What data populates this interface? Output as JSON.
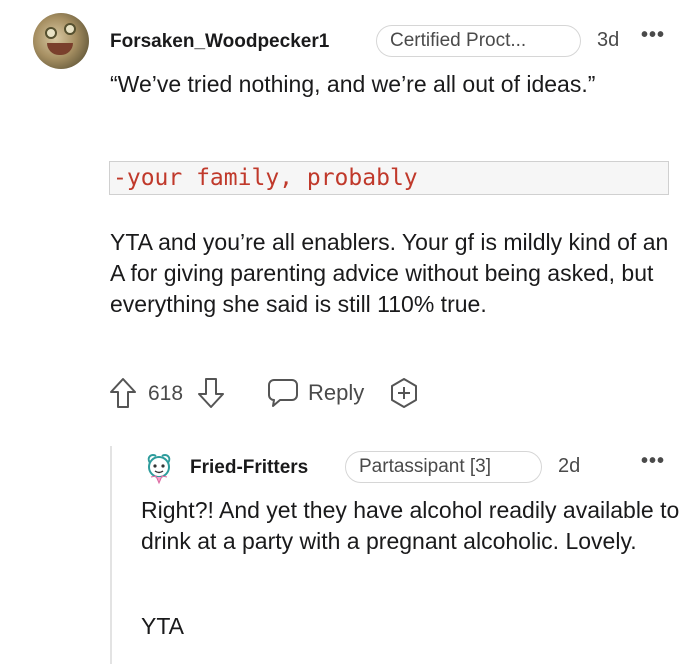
{
  "comment": {
    "username": "Forsaken_Woodpecker1",
    "flair": "Certified Proct...",
    "age": "3d",
    "more": "•••",
    "quote": "“We’ve tried nothing, and we’re all out of ideas.”",
    "code": "-your family, probably",
    "paragraph": "YTA and you’re all enablers. Your gf is mildly kind of an A for giving parenting advice without being asked, but everything she said is still 110% true.",
    "score": "618",
    "reply_label": "Reply",
    "icons": [
      "upvote-icon",
      "downvote-icon",
      "reply-icon",
      "award-icon",
      "more-icon"
    ]
  },
  "reply": {
    "username": "Fried-Fritters",
    "flair": "Partassipant [3]",
    "age": "2d",
    "more": "•••",
    "paragraph1": "Right?! And yet they have alcohol readily available to drink at a party with a pregnant alcoholic. Lovely.",
    "paragraph2": "YTA"
  },
  "colors": {
    "text": "#1a1a1b",
    "muted": "#4a4a4a",
    "code_text": "#c0392b",
    "code_bg": "#f6f6f6",
    "thread_line": "#e3e3e3"
  }
}
